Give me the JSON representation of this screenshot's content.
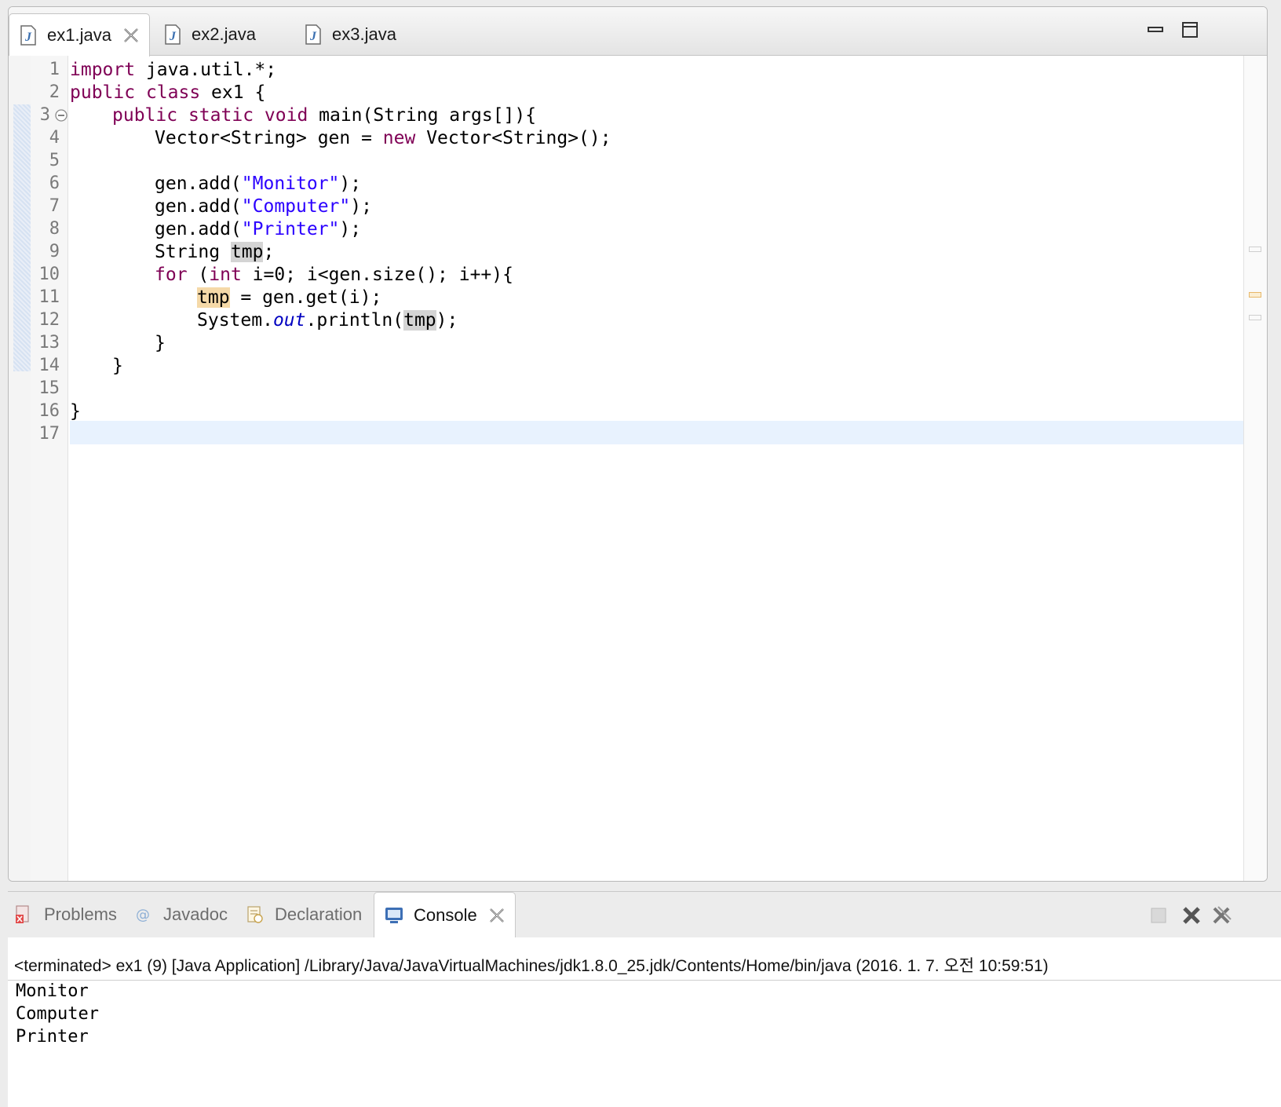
{
  "editor": {
    "tabs": [
      {
        "label": "ex1.java",
        "active": true,
        "closable": true
      },
      {
        "label": "ex2.java",
        "active": false
      },
      {
        "label": "ex3.java",
        "active": false
      }
    ],
    "line_numbers": [
      "1",
      "2",
      "3",
      "4",
      "5",
      "6",
      "7",
      "8",
      "9",
      "10",
      "11",
      "12",
      "13",
      "14",
      "15",
      "16",
      "17"
    ],
    "current_line": "17",
    "colors": {
      "keyword": "#7f0055",
      "string": "#2a00ff",
      "field": "#0000c0",
      "current_line_bg": "#e8f2fe",
      "occurrence_bg": "#d4d4d4",
      "write_occurrence_bg": "#f5d9a8"
    },
    "code": {
      "l1": {
        "kw": "import",
        "rest": " java.util.*;"
      },
      "l2": {
        "kw1": "public",
        "kw2": "class",
        "rest": " ex1 {"
      },
      "l3": {
        "kw1": "public",
        "kw2": "static",
        "kw3": "void",
        "rest": " main(String args[]){"
      },
      "l4": {
        "a": "Vector<String> gen = ",
        "kw": "new",
        "b": " Vector<String>();"
      },
      "l6": {
        "a": "gen.add(",
        "str": "\"Monitor\"",
        "b": ");"
      },
      "l7": {
        "a": "gen.add(",
        "str": "\"Computer\"",
        "b": ");"
      },
      "l8": {
        "a": "gen.add(",
        "str": "\"Printer\"",
        "b": ");"
      },
      "l9": {
        "a": "String ",
        "var": "tmp",
        "b": ";"
      },
      "l10": {
        "kw1": "for",
        "a": " (",
        "kw2": "int",
        "b": " i=0; i<gen.size(); i++){"
      },
      "l11": {
        "var": "tmp",
        "b": " = gen.get(i);"
      },
      "l12": {
        "a": "System.",
        "fld": "out",
        "b": ".println(",
        "var": "tmp",
        "c": ");"
      },
      "l13": "}",
      "l14": "}",
      "l16": "}"
    }
  },
  "console": {
    "tabs": [
      {
        "label": "Problems",
        "icon": "problems-icon",
        "active": false
      },
      {
        "label": "Javadoc",
        "icon": "javadoc-icon",
        "active": false
      },
      {
        "label": "Declaration",
        "icon": "declaration-icon",
        "active": false
      },
      {
        "label": "Console",
        "icon": "console-icon",
        "active": true,
        "closable": true
      }
    ],
    "header": "<terminated> ex1 (9) [Java Application] /Library/Java/JavaVirtualMachines/jdk1.8.0_25.jdk/Contents/Home/bin/java (2016. 1. 7. 오전 10:59:51)",
    "output": [
      "Monitor",
      "Computer",
      "Printer"
    ]
  }
}
